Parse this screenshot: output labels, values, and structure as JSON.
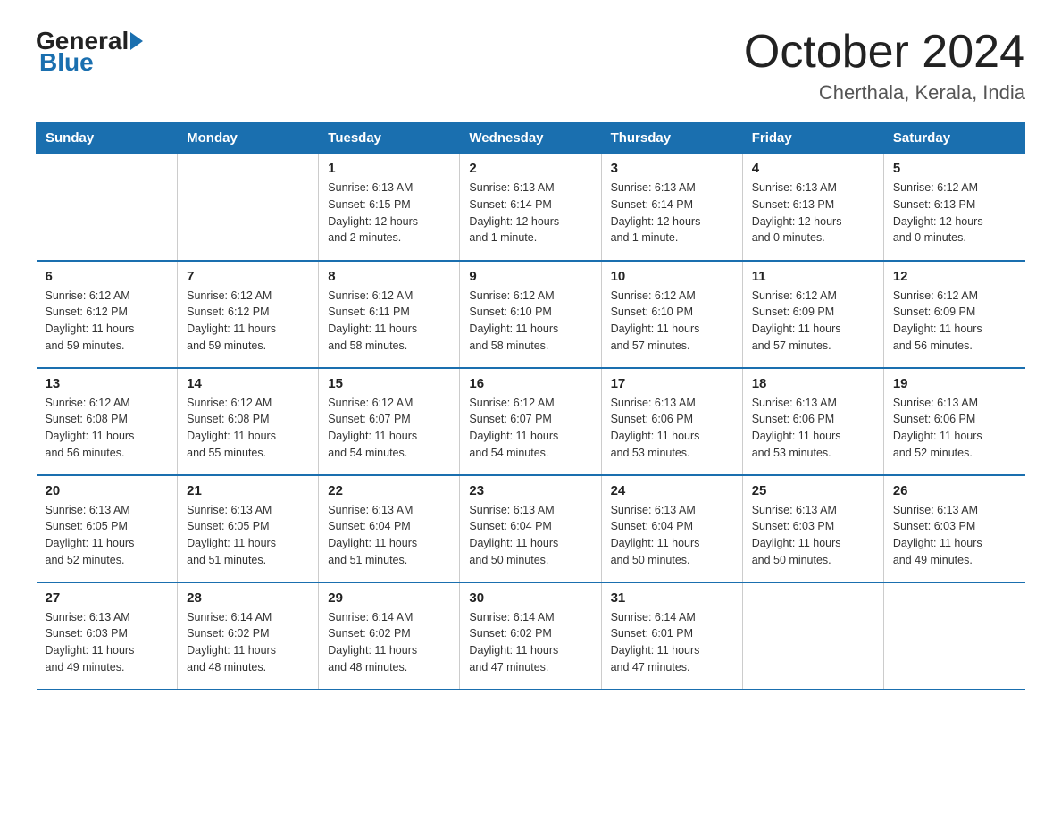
{
  "header": {
    "logo_general": "General",
    "logo_blue": "Blue",
    "title": "October 2024",
    "location": "Cherthala, Kerala, India"
  },
  "weekdays": [
    "Sunday",
    "Monday",
    "Tuesday",
    "Wednesday",
    "Thursday",
    "Friday",
    "Saturday"
  ],
  "weeks": [
    [
      {
        "day": "",
        "info": ""
      },
      {
        "day": "",
        "info": ""
      },
      {
        "day": "1",
        "info": "Sunrise: 6:13 AM\nSunset: 6:15 PM\nDaylight: 12 hours\nand 2 minutes."
      },
      {
        "day": "2",
        "info": "Sunrise: 6:13 AM\nSunset: 6:14 PM\nDaylight: 12 hours\nand 1 minute."
      },
      {
        "day": "3",
        "info": "Sunrise: 6:13 AM\nSunset: 6:14 PM\nDaylight: 12 hours\nand 1 minute."
      },
      {
        "day": "4",
        "info": "Sunrise: 6:13 AM\nSunset: 6:13 PM\nDaylight: 12 hours\nand 0 minutes."
      },
      {
        "day": "5",
        "info": "Sunrise: 6:12 AM\nSunset: 6:13 PM\nDaylight: 12 hours\nand 0 minutes."
      }
    ],
    [
      {
        "day": "6",
        "info": "Sunrise: 6:12 AM\nSunset: 6:12 PM\nDaylight: 11 hours\nand 59 minutes."
      },
      {
        "day": "7",
        "info": "Sunrise: 6:12 AM\nSunset: 6:12 PM\nDaylight: 11 hours\nand 59 minutes."
      },
      {
        "day": "8",
        "info": "Sunrise: 6:12 AM\nSunset: 6:11 PM\nDaylight: 11 hours\nand 58 minutes."
      },
      {
        "day": "9",
        "info": "Sunrise: 6:12 AM\nSunset: 6:10 PM\nDaylight: 11 hours\nand 58 minutes."
      },
      {
        "day": "10",
        "info": "Sunrise: 6:12 AM\nSunset: 6:10 PM\nDaylight: 11 hours\nand 57 minutes."
      },
      {
        "day": "11",
        "info": "Sunrise: 6:12 AM\nSunset: 6:09 PM\nDaylight: 11 hours\nand 57 minutes."
      },
      {
        "day": "12",
        "info": "Sunrise: 6:12 AM\nSunset: 6:09 PM\nDaylight: 11 hours\nand 56 minutes."
      }
    ],
    [
      {
        "day": "13",
        "info": "Sunrise: 6:12 AM\nSunset: 6:08 PM\nDaylight: 11 hours\nand 56 minutes."
      },
      {
        "day": "14",
        "info": "Sunrise: 6:12 AM\nSunset: 6:08 PM\nDaylight: 11 hours\nand 55 minutes."
      },
      {
        "day": "15",
        "info": "Sunrise: 6:12 AM\nSunset: 6:07 PM\nDaylight: 11 hours\nand 54 minutes."
      },
      {
        "day": "16",
        "info": "Sunrise: 6:12 AM\nSunset: 6:07 PM\nDaylight: 11 hours\nand 54 minutes."
      },
      {
        "day": "17",
        "info": "Sunrise: 6:13 AM\nSunset: 6:06 PM\nDaylight: 11 hours\nand 53 minutes."
      },
      {
        "day": "18",
        "info": "Sunrise: 6:13 AM\nSunset: 6:06 PM\nDaylight: 11 hours\nand 53 minutes."
      },
      {
        "day": "19",
        "info": "Sunrise: 6:13 AM\nSunset: 6:06 PM\nDaylight: 11 hours\nand 52 minutes."
      }
    ],
    [
      {
        "day": "20",
        "info": "Sunrise: 6:13 AM\nSunset: 6:05 PM\nDaylight: 11 hours\nand 52 minutes."
      },
      {
        "day": "21",
        "info": "Sunrise: 6:13 AM\nSunset: 6:05 PM\nDaylight: 11 hours\nand 51 minutes."
      },
      {
        "day": "22",
        "info": "Sunrise: 6:13 AM\nSunset: 6:04 PM\nDaylight: 11 hours\nand 51 minutes."
      },
      {
        "day": "23",
        "info": "Sunrise: 6:13 AM\nSunset: 6:04 PM\nDaylight: 11 hours\nand 50 minutes."
      },
      {
        "day": "24",
        "info": "Sunrise: 6:13 AM\nSunset: 6:04 PM\nDaylight: 11 hours\nand 50 minutes."
      },
      {
        "day": "25",
        "info": "Sunrise: 6:13 AM\nSunset: 6:03 PM\nDaylight: 11 hours\nand 50 minutes."
      },
      {
        "day": "26",
        "info": "Sunrise: 6:13 AM\nSunset: 6:03 PM\nDaylight: 11 hours\nand 49 minutes."
      }
    ],
    [
      {
        "day": "27",
        "info": "Sunrise: 6:13 AM\nSunset: 6:03 PM\nDaylight: 11 hours\nand 49 minutes."
      },
      {
        "day": "28",
        "info": "Sunrise: 6:14 AM\nSunset: 6:02 PM\nDaylight: 11 hours\nand 48 minutes."
      },
      {
        "day": "29",
        "info": "Sunrise: 6:14 AM\nSunset: 6:02 PM\nDaylight: 11 hours\nand 48 minutes."
      },
      {
        "day": "30",
        "info": "Sunrise: 6:14 AM\nSunset: 6:02 PM\nDaylight: 11 hours\nand 47 minutes."
      },
      {
        "day": "31",
        "info": "Sunrise: 6:14 AM\nSunset: 6:01 PM\nDaylight: 11 hours\nand 47 minutes."
      },
      {
        "day": "",
        "info": ""
      },
      {
        "day": "",
        "info": ""
      }
    ]
  ]
}
